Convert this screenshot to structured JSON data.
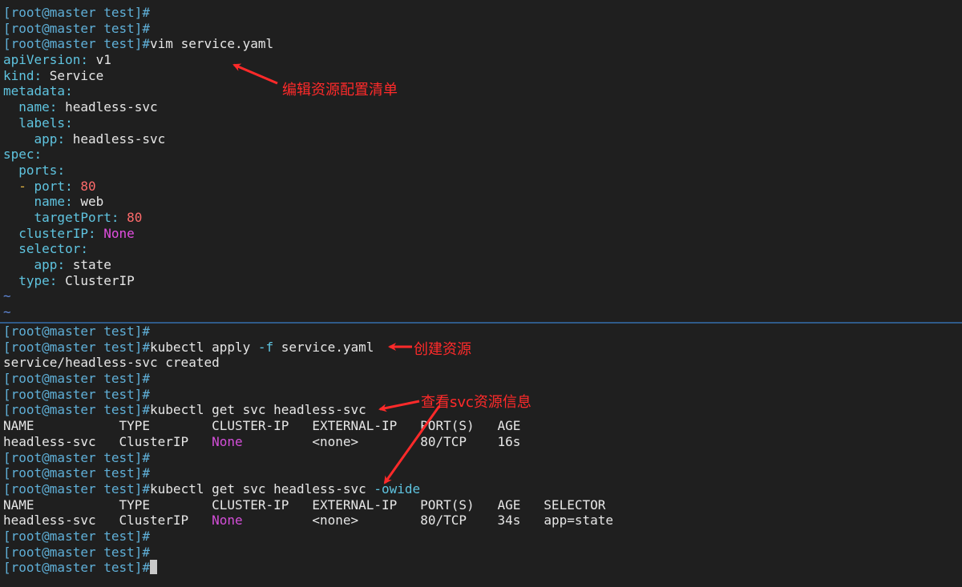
{
  "prompt": "[root@master test]#",
  "editor": {
    "lines": [
      {
        "type": "prompt",
        "cmd": ""
      },
      {
        "type": "prompt",
        "cmd": ""
      },
      {
        "type": "prompt",
        "cmd": "vim service.yaml"
      },
      {
        "type": "yaml",
        "indent": "",
        "key": "apiVersion",
        "sep": ": ",
        "value": "v1",
        "vclass": "c-text"
      },
      {
        "type": "yaml",
        "indent": "",
        "key": "kind",
        "sep": ": ",
        "value": "Service",
        "vclass": "c-text"
      },
      {
        "type": "yaml",
        "indent": "",
        "key": "metadata",
        "sep": ":",
        "value": "",
        "vclass": "c-text"
      },
      {
        "type": "yaml",
        "indent": "  ",
        "key": "name",
        "sep": ": ",
        "value": "headless-svc",
        "vclass": "c-text"
      },
      {
        "type": "yaml",
        "indent": "  ",
        "key": "labels",
        "sep": ":",
        "value": "",
        "vclass": "c-text"
      },
      {
        "type": "yaml",
        "indent": "    ",
        "key": "app",
        "sep": ": ",
        "value": "headless-svc",
        "vclass": "c-text"
      },
      {
        "type": "yaml",
        "indent": "",
        "key": "spec",
        "sep": ":",
        "value": "",
        "vclass": "c-text"
      },
      {
        "type": "yaml",
        "indent": "  ",
        "key": "ports",
        "sep": ":",
        "value": "",
        "vclass": "c-text"
      },
      {
        "type": "yaml-dash",
        "indent": "  ",
        "dash": "- ",
        "key": "port",
        "sep": ": ",
        "value": "80",
        "vclass": "c-num"
      },
      {
        "type": "yaml",
        "indent": "    ",
        "key": "name",
        "sep": ": ",
        "value": "web",
        "vclass": "c-text"
      },
      {
        "type": "yaml",
        "indent": "    ",
        "key": "targetPort",
        "sep": ": ",
        "value": "80",
        "vclass": "c-num"
      },
      {
        "type": "yaml",
        "indent": "  ",
        "key": "clusterIP",
        "sep": ": ",
        "value": "None",
        "vclass": "c-kw"
      },
      {
        "type": "yaml",
        "indent": "  ",
        "key": "selector",
        "sep": ":",
        "value": "",
        "vclass": "c-text"
      },
      {
        "type": "yaml",
        "indent": "    ",
        "key": "app",
        "sep": ": ",
        "value": "state",
        "vclass": "c-text"
      },
      {
        "type": "yaml",
        "indent": "  ",
        "key": "type",
        "sep": ": ",
        "value": "ClusterIP",
        "vclass": "c-text"
      },
      {
        "type": "tilde",
        "text": "~"
      },
      {
        "type": "tilde",
        "text": "~"
      }
    ]
  },
  "terminal": {
    "lines": [
      {
        "type": "prompt",
        "cmd": ""
      },
      {
        "type": "prompt-flag",
        "cmd1": "kubectl apply ",
        "flag": "-f",
        "cmd2": " service.yaml"
      },
      {
        "type": "out",
        "text": "service/headless-svc created"
      },
      {
        "type": "prompt",
        "cmd": ""
      },
      {
        "type": "prompt",
        "cmd": ""
      },
      {
        "type": "prompt",
        "cmd": "kubectl get svc headless-svc"
      },
      {
        "type": "out",
        "text": "NAME           TYPE        CLUSTER-IP   EXTERNAL-IP   PORT(S)   AGE"
      },
      {
        "type": "row",
        "c1": "headless-svc   ClusterIP   ",
        "ip": "None",
        "c2": "         ",
        "ext": "<none>",
        "c3": "        80/TCP    16s"
      },
      {
        "type": "prompt",
        "cmd": ""
      },
      {
        "type": "prompt",
        "cmd": ""
      },
      {
        "type": "prompt-flag",
        "cmd1": "kubectl get svc headless-svc ",
        "flag": "-owide",
        "cmd2": ""
      },
      {
        "type": "out",
        "text": "NAME           TYPE        CLUSTER-IP   EXTERNAL-IP   PORT(S)   AGE   SELECTOR"
      },
      {
        "type": "row",
        "c1": "headless-svc   ClusterIP   ",
        "ip": "None",
        "c2": "         ",
        "ext": "<none>",
        "c3": "        80/TCP    34s   app=state"
      },
      {
        "type": "prompt",
        "cmd": ""
      },
      {
        "type": "prompt",
        "cmd": ""
      },
      {
        "type": "prompt-cursor",
        "cmd": ""
      }
    ]
  },
  "annotations": {
    "edit": "编辑资源配置清单",
    "create": "创建资源",
    "view": "查看svc资源信息"
  },
  "colors": {
    "background": "#1f1f1f",
    "prompt": "#5fafd7",
    "annotation": "#ff2a2a",
    "divider": "#2f5a8a"
  }
}
